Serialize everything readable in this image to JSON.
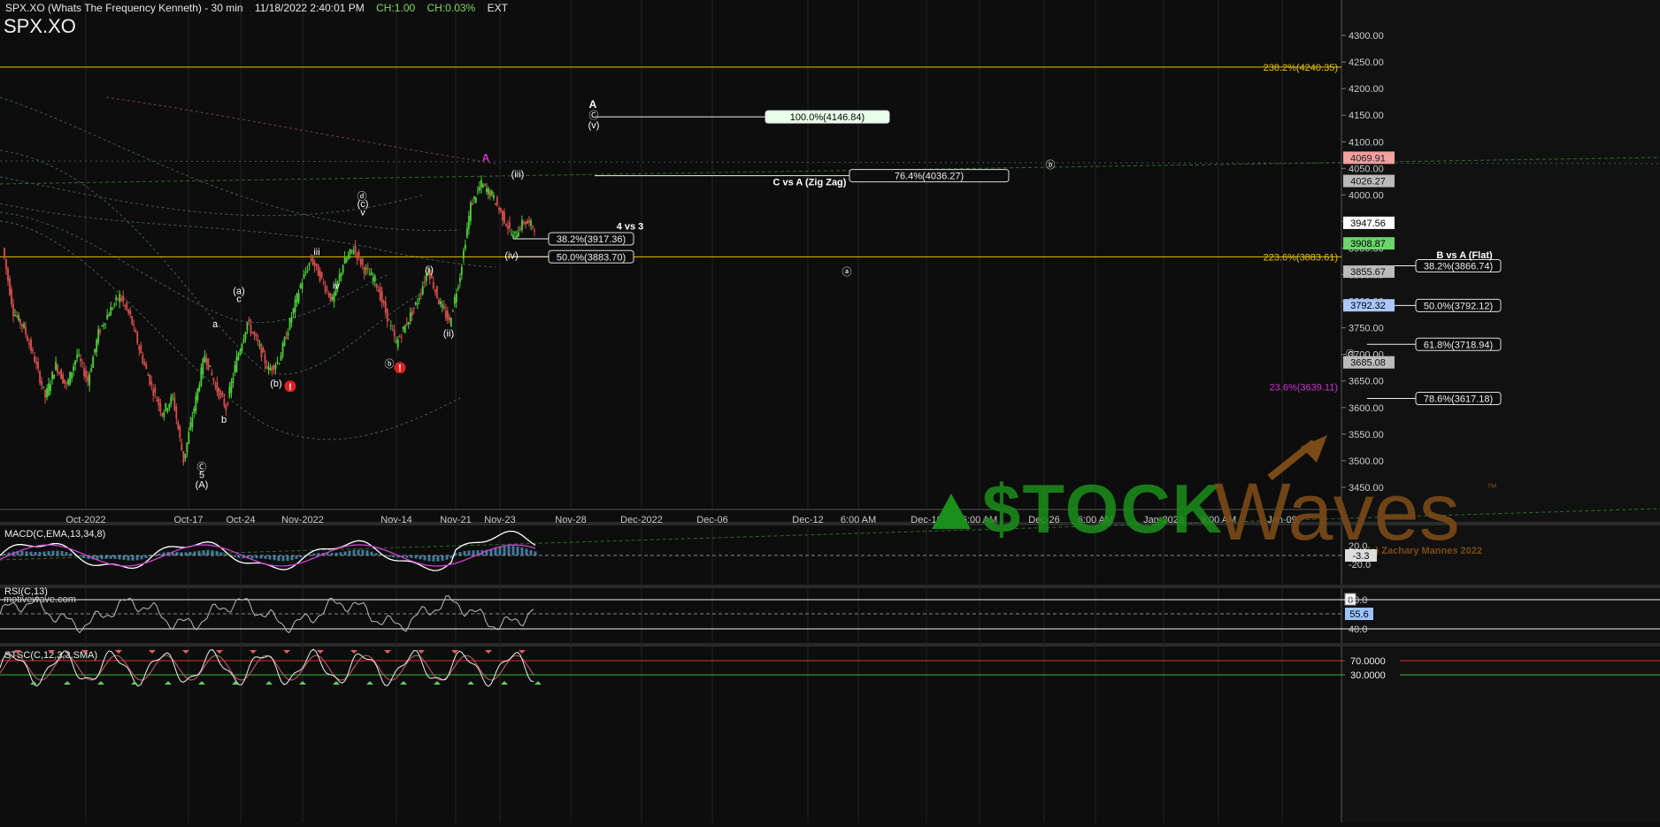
{
  "header": {
    "title": "SPX.XO (Whats The Frequency Kenneth) - 30 min",
    "datetime": "11/18/2022 2:40:01 PM",
    "change": "CH:1.00",
    "change_pct": "CH:0.03%",
    "session": "EXT",
    "symbol": "SPX.XO"
  },
  "footer_credit": "motivewave.com",
  "watermark": {
    "brand_left": "$TOCK",
    "brand_right": "Waves",
    "tm": "™",
    "copyright": "(c) Zachary Mannes 2022"
  },
  "colors": {
    "background": "#0d0d0d",
    "up": "#4fd13a",
    "down": "#d95050",
    "fib_gold": "#e6c200",
    "magenta": "#cc33cc",
    "green_brand": "#1a8f1a",
    "brown_brand": "#7a4a17"
  },
  "chart_data": [
    {
      "type": "line",
      "name": "price",
      "y_axis": {
        "ylim": [
          3410,
          4350
        ],
        "ticks": [
          3450,
          3500,
          3550,
          3600,
          3650,
          3700,
          3750,
          3800,
          3850,
          3900,
          3950,
          4000,
          4050,
          4100,
          4150,
          4200,
          4250,
          4300
        ],
        "tick_labels": [
          "3450.00",
          "3500.00",
          "3550.00",
          "3600.00",
          "3650.00",
          "3700.00",
          "3750.00",
          "3800.00",
          "3850.00",
          "3900.00",
          "3950.00",
          "4000.00",
          "4050.00",
          "4100.00",
          "4150.00",
          "4200.00",
          "4250.00",
          "4300.00"
        ],
        "zero_label": "0"
      },
      "x_axis": {
        "tick_labels": [
          "Oct-2022",
          "Oct-17",
          "Oct-24",
          "Nov-2022",
          "Nov-14",
          "Nov-21",
          "Nov-23",
          "Nov-28",
          "Dec-2022",
          "Dec-06",
          "Dec-12",
          "6:00 AM",
          "Dec-19",
          "6:00 AM",
          "Dec-26",
          "6:00 AM",
          "Jan-2023",
          "9:00 AM",
          "Jan-09"
        ]
      },
      "price_series": [
        3900,
        3780,
        3750,
        3690,
        3620,
        3680,
        3640,
        3700,
        3650,
        3740,
        3780,
        3810,
        3770,
        3700,
        3640,
        3590,
        3620,
        3500,
        3600,
        3700,
        3640,
        3600,
        3690,
        3760,
        3720,
        3670,
        3690,
        3760,
        3830,
        3880,
        3840,
        3800,
        3870,
        3900,
        3860,
        3840,
        3780,
        3720,
        3760,
        3800,
        3860,
        3800,
        3760,
        3850,
        3980,
        4020,
        4000,
        3960,
        3920,
        3950,
        3940
      ],
      "price_tags": [
        {
          "value": 4069.91,
          "label": "4069.91",
          "style": "red"
        },
        {
          "value": 4026.27,
          "label": "4026.27",
          "style": "gray"
        },
        {
          "value": 3947.56,
          "label": "3947.56",
          "style": "white"
        },
        {
          "value": 3908.87,
          "label": "3908.87",
          "style": "green"
        },
        {
          "value": 3855.67,
          "label": "3855.67",
          "style": "gray"
        },
        {
          "value": 3792.32,
          "label": "3792.32",
          "style": "blue"
        },
        {
          "value": 3685.08,
          "label": "3685.08",
          "style": "gray"
        }
      ],
      "fib_gold_levels": [
        {
          "value": 4240.35,
          "label": "238.2%(4240.35)"
        },
        {
          "value": 3883.61,
          "label": "223.6%(3883.61)"
        }
      ],
      "fib_magenta_levels": [
        {
          "value": 3639.11,
          "label": "23.6%(3639.11)"
        }
      ],
      "fib_boxes": [
        {
          "value": 4146.84,
          "label": "100.0%(4146.84)",
          "highlight": true
        },
        {
          "value": 4036.27,
          "label": "76.4%(4036.27)"
        },
        {
          "value": 3917.36,
          "label": "38.2%(3917.36)"
        },
        {
          "value": 3883.7,
          "label": "50.0%(3883.70)"
        },
        {
          "value": 3866.74,
          "label": "38.2%(3866.74)"
        },
        {
          "value": 3792.12,
          "label": "50.0%(3792.12)"
        },
        {
          "value": 3718.94,
          "label": "61.8%(3718.94)"
        },
        {
          "value": 3617.18,
          "label": "78.6%(3617.18)"
        }
      ],
      "annotations": [
        "C vs A (Zig Zag)",
        "4 vs 3",
        "B vs A (Flat)"
      ],
      "wave_labels": [
        {
          "text": "A",
          "value": 4170,
          "style": "bold"
        },
        {
          "text": "Ⓒ",
          "value": 4150
        },
        {
          "text": "(v)",
          "value": 4132
        },
        {
          "text": "A",
          "value": 4070,
          "style": "magenta"
        },
        {
          "text": "(iii)",
          "value": 4040
        },
        {
          "text": "(iv)",
          "value": 3887
        },
        {
          "text": "ⓓ",
          "value": 3998
        },
        {
          "text": "(c)",
          "value": 3984
        },
        {
          "text": "v",
          "value": 3968
        },
        {
          "text": "iii",
          "value": 3893
        },
        {
          "text": "iv",
          "value": 3830
        },
        {
          "text": "(i)",
          "value": 3860
        },
        {
          "text": "(ii)",
          "value": 3740
        },
        {
          "text": "ⓑ",
          "value": 3683
        },
        {
          "text": "(a)",
          "value": 3820
        },
        {
          "text": "c",
          "value": 3805
        },
        {
          "text": "a",
          "value": 3758
        },
        {
          "text": "b",
          "value": 3578
        },
        {
          "text": "(b)",
          "value": 3646
        },
        {
          "text": "Ⓒ",
          "value": 3489
        },
        {
          "text": "5",
          "value": 3474
        },
        {
          "text": "(A)",
          "value": 3456
        },
        {
          "text": "ⓑ",
          "value": 4057
        },
        {
          "text": "ⓐ",
          "value": 3856
        },
        {
          "text": "Ⓒ",
          "value": 3700
        },
        {
          "text": "B",
          "value": 3685
        }
      ]
    },
    {
      "type": "line",
      "name": "macd",
      "title": "MACD(C,EMA,13,34,8)",
      "y_ticks": [
        "20.0",
        "-20.0"
      ],
      "current": "-3.3"
    },
    {
      "type": "line",
      "name": "rsi",
      "title": "RSI(C,13)",
      "y_ticks": [
        "80.0",
        "40.0"
      ],
      "current": "55.6"
    },
    {
      "type": "line",
      "name": "stochastic",
      "title": "STSC(C,12,3,3,SMA)",
      "y_ticks": [
        "70.0000",
        "30.0000"
      ]
    }
  ]
}
